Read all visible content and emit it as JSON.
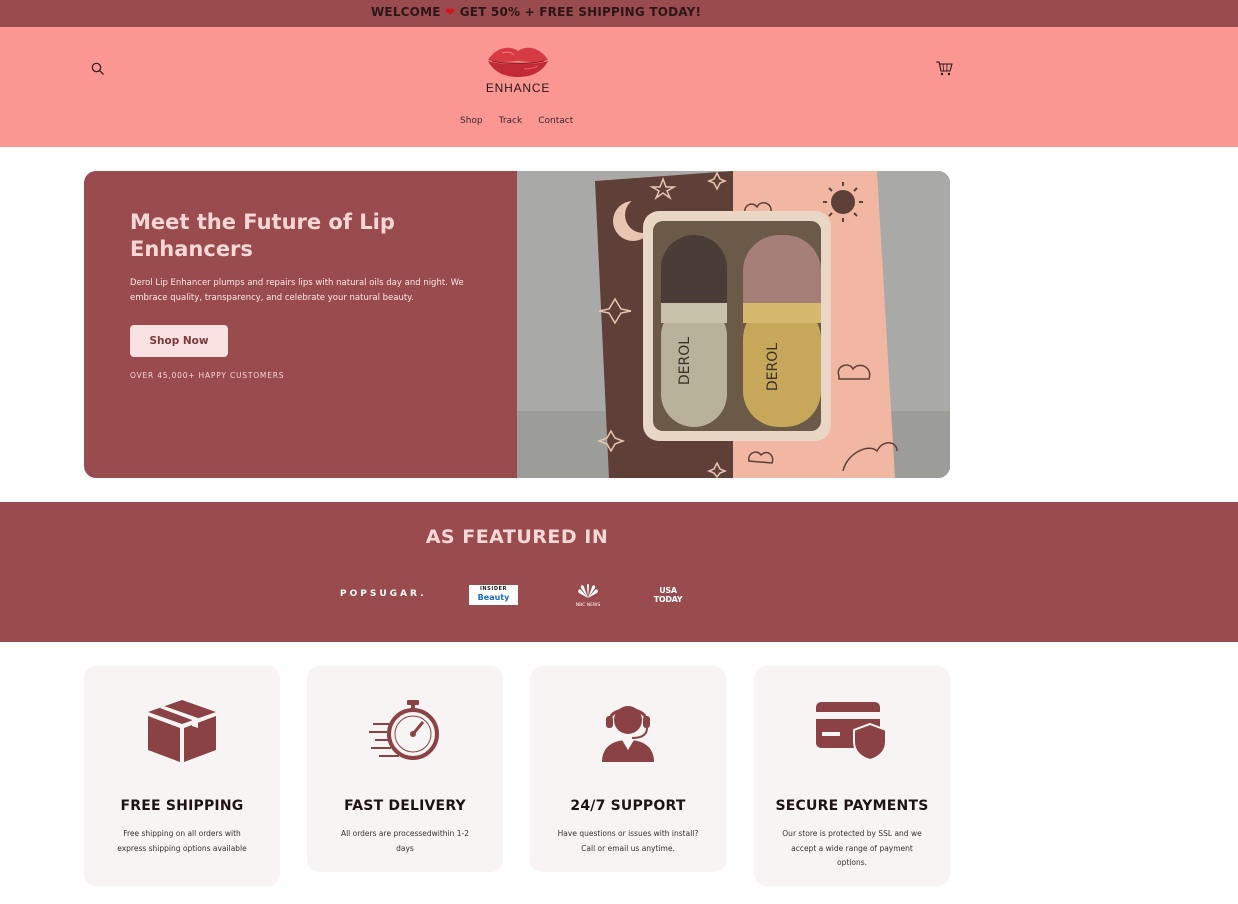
{
  "announcement": {
    "before": "WELCOME",
    "icon": "heart-icon",
    "after": "GET 50% + FREE SHIPPING TODAY!"
  },
  "header": {
    "logo_text": "ENHANCE",
    "search_icon": "search-icon",
    "cart_icon": "cart-icon",
    "nav": [
      {
        "label": "Shop"
      },
      {
        "label": "Track"
      },
      {
        "label": "Contact"
      }
    ]
  },
  "hero": {
    "title": "Meet the Future of Lip Enhancers",
    "description": "Derol Lip Enhancer plumps and repairs lips with natural oils day and night. We embrace quality, transparency, and celebrate your natural beauty.",
    "button": "Shop Now",
    "customers": "OVER 45,000+ HAPPY CUSTOMERS",
    "product_label": "DEROL"
  },
  "featured": {
    "title": "AS FEATURED IN",
    "brands": {
      "popsugar": "POPSUGAR.",
      "insider_top": "INSIDER",
      "insider_bottom": "Beauty",
      "nbc": "NBC NEWS",
      "usa_1": "USA",
      "usa_2": "TODAY"
    }
  },
  "features": [
    {
      "title": "FREE SHIPPING",
      "description": "Free shipping on all orders with express shipping options available",
      "icon": "box-icon"
    },
    {
      "title": "FAST DELIVERY",
      "description": "All orders are processedwithin 1-2 days",
      "icon": "stopwatch-icon"
    },
    {
      "title": "24/7 SUPPORT",
      "description": "Have questions or issues with install? Call or email us anytime.",
      "icon": "headset-icon"
    },
    {
      "title": "SECURE PAYMENTS",
      "description": "Our store is protected by SSL and we accept a wide range of payment options.",
      "icon": "card-shield-icon"
    }
  ],
  "colors": {
    "primary": "#9a4b4d",
    "header_bg": "#fa9793",
    "card_bg": "#f8f4f4",
    "heart": "#d01822"
  }
}
